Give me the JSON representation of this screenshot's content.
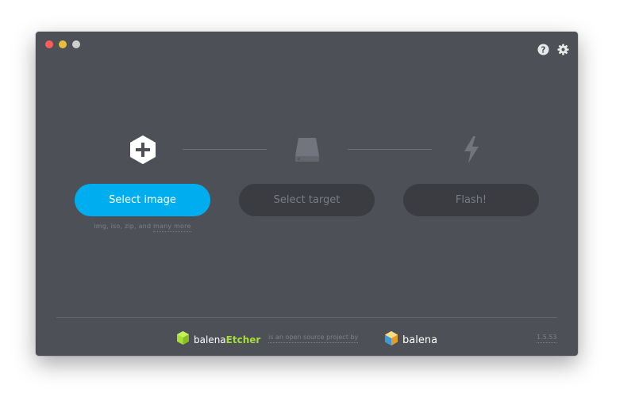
{
  "window": {
    "controls": [
      "close",
      "minimize",
      "zoom"
    ],
    "top_icons": [
      "help-icon",
      "settings-icon"
    ]
  },
  "steps": {
    "image": {
      "icon": "plus-hexagon-icon",
      "button_label": "Select image",
      "hint_prefix": "img, iso, zip, and",
      "hint_link": "many more"
    },
    "target": {
      "icon": "drive-icon",
      "button_label": "Select target"
    },
    "flash": {
      "icon": "lightning-icon",
      "button_label": "Flash!"
    }
  },
  "footer": {
    "brand_prefix": "balena",
    "brand_accent": "Etcher",
    "middle_text": "is an open source project by",
    "company": "balena",
    "version": "1.5.53"
  },
  "colors": {
    "background": "#4d5057",
    "primary": "#00aeef",
    "disabled_button": "#3a3c41",
    "etcher_green": "#a5de37"
  }
}
